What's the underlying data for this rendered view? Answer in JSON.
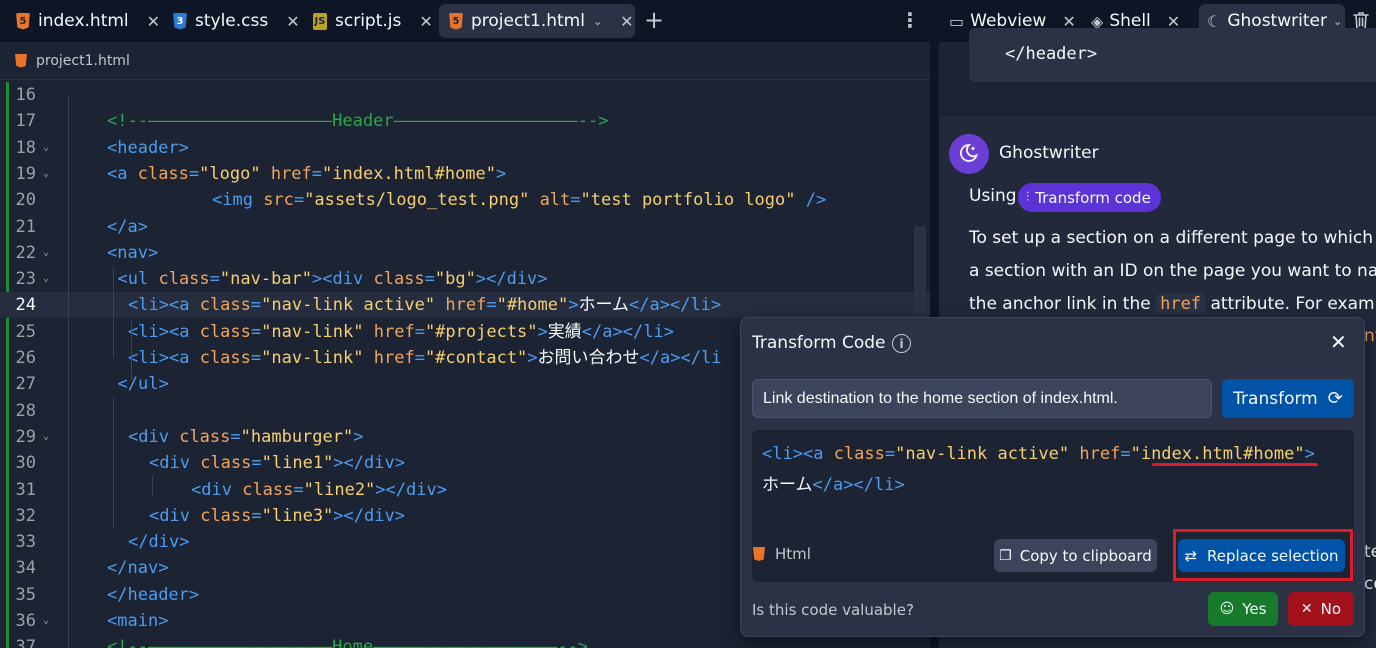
{
  "editor": {
    "tabs": [
      {
        "label": "index.html",
        "icon": "html-file-icon"
      },
      {
        "label": "style.css",
        "icon": "css-file-icon"
      },
      {
        "label": "script.js",
        "icon": "js-file-icon"
      },
      {
        "label": "project1.html",
        "icon": "html-file-icon",
        "active": true
      }
    ],
    "breadcrumb": "project1.html",
    "lines": [
      {
        "n": "16",
        "segs": []
      },
      {
        "n": "17",
        "segs": [
          [
            "com",
            "<!--――――――――――――――――――Header――――――――――――――――――-->"
          ]
        ]
      },
      {
        "n": "18",
        "fold": true,
        "segs": [
          [
            "tag",
            "<header"
          ],
          [
            "tag",
            ">"
          ]
        ]
      },
      {
        "n": "19",
        "fold": true,
        "segs": [
          [
            "tag",
            "<a "
          ],
          [
            "attr",
            "class"
          ],
          [
            "p",
            "="
          ],
          [
            "str",
            "\"logo\" "
          ],
          [
            "attr",
            "href"
          ],
          [
            "p",
            "="
          ],
          [
            "str",
            "\"index.html#home\""
          ],
          [
            "p",
            ">"
          ]
        ]
      },
      {
        "n": "20",
        "segs": [
          [
            "tag",
            "<img "
          ],
          [
            "attr",
            "src"
          ],
          [
            "p",
            "="
          ],
          [
            "str",
            "\"assets/logo_test.png\" "
          ],
          [
            "attr",
            "alt"
          ],
          [
            "p",
            "="
          ],
          [
            "str",
            "\"test portfolio logo\" "
          ],
          [
            "p",
            "/>"
          ]
        ]
      },
      {
        "n": "21",
        "segs": [
          [
            "p",
            "</"
          ],
          [
            "tag",
            "a"
          ],
          [
            "p",
            ">"
          ]
        ]
      },
      {
        "n": "22",
        "fold": true,
        "segs": [
          [
            "p",
            "<"
          ],
          [
            "tag",
            "nav"
          ],
          [
            "p",
            ">"
          ]
        ]
      },
      {
        "n": "23",
        "fold": true,
        "segs": [
          [
            "p",
            "<"
          ],
          [
            "tag",
            "ul "
          ],
          [
            "attr",
            "class"
          ],
          [
            "p",
            "="
          ],
          [
            "str",
            "\"nav-bar\""
          ],
          [
            "p",
            "><"
          ],
          [
            "tag",
            "div "
          ],
          [
            "attr",
            "class"
          ],
          [
            "p",
            "="
          ],
          [
            "str",
            "\"bg\""
          ],
          [
            "p",
            "></"
          ],
          [
            "tag",
            "div"
          ],
          [
            "p",
            ">"
          ]
        ]
      },
      {
        "n": "24",
        "segs": [
          [
            "p",
            "<"
          ],
          [
            "tag",
            "li"
          ],
          [
            "p",
            "><"
          ],
          [
            "tag",
            "a "
          ],
          [
            "attr",
            "class"
          ],
          [
            "p",
            "="
          ],
          [
            "str",
            "\"nav-link active\" "
          ],
          [
            "attr",
            "href"
          ],
          [
            "p",
            "="
          ],
          [
            "str",
            "\"#home\""
          ],
          [
            "p",
            ">"
          ],
          [
            "txt",
            "ホーム"
          ],
          [
            "p",
            "</"
          ],
          [
            "tag",
            "a"
          ],
          [
            "p",
            "></"
          ],
          [
            "tag",
            "li"
          ],
          [
            "p",
            ">"
          ]
        ]
      },
      {
        "n": "25",
        "segs": [
          [
            "p",
            "<"
          ],
          [
            "tag",
            "li"
          ],
          [
            "p",
            "><"
          ],
          [
            "tag",
            "a "
          ],
          [
            "attr",
            "class"
          ],
          [
            "p",
            "="
          ],
          [
            "str",
            "\"nav-link\" "
          ],
          [
            "attr",
            "href"
          ],
          [
            "p",
            "="
          ],
          [
            "str",
            "\"#projects\""
          ],
          [
            "p",
            ">"
          ],
          [
            "txt",
            "実績"
          ],
          [
            "p",
            "</"
          ],
          [
            "tag",
            "a"
          ],
          [
            "p",
            "></"
          ],
          [
            "tag",
            "li"
          ],
          [
            "p",
            ">"
          ]
        ]
      },
      {
        "n": "26",
        "segs": [
          [
            "p",
            "<"
          ],
          [
            "tag",
            "li"
          ],
          [
            "p",
            "><"
          ],
          [
            "tag",
            "a "
          ],
          [
            "attr",
            "class"
          ],
          [
            "p",
            "="
          ],
          [
            "str",
            "\"nav-link\" "
          ],
          [
            "attr",
            "href"
          ],
          [
            "p",
            "="
          ],
          [
            "str",
            "\"#contact\""
          ],
          [
            "p",
            ">"
          ],
          [
            "txt",
            "お問い合わせ"
          ],
          [
            "p",
            "</"
          ],
          [
            "tag",
            "a"
          ],
          [
            "p",
            "></"
          ],
          [
            "tag",
            "li"
          ]
        ]
      },
      {
        "n": "27",
        "segs": [
          [
            "p",
            "</"
          ],
          [
            "tag",
            "ul"
          ],
          [
            "p",
            ">"
          ]
        ]
      },
      {
        "n": "28",
        "segs": []
      },
      {
        "n": "29",
        "fold": true,
        "segs": [
          [
            "p",
            "<"
          ],
          [
            "tag",
            "div "
          ],
          [
            "attr",
            "class"
          ],
          [
            "p",
            "="
          ],
          [
            "str",
            "\"hamburger\""
          ],
          [
            "p",
            ">"
          ]
        ]
      },
      {
        "n": "30",
        "segs": [
          [
            "p",
            "<"
          ],
          [
            "tag",
            "div "
          ],
          [
            "attr",
            "class"
          ],
          [
            "p",
            "="
          ],
          [
            "str",
            "\"line1\""
          ],
          [
            "p",
            "></"
          ],
          [
            "tag",
            "div"
          ],
          [
            "p",
            ">"
          ]
        ]
      },
      {
        "n": "31",
        "segs": [
          [
            "p",
            "<"
          ],
          [
            "tag",
            "div "
          ],
          [
            "attr",
            "class"
          ],
          [
            "p",
            "="
          ],
          [
            "str",
            "\"line2\""
          ],
          [
            "p",
            "></"
          ],
          [
            "tag",
            "div"
          ],
          [
            "p",
            ">"
          ]
        ]
      },
      {
        "n": "32",
        "segs": [
          [
            "p",
            "<"
          ],
          [
            "tag",
            "div "
          ],
          [
            "attr",
            "class"
          ],
          [
            "p",
            "="
          ],
          [
            "str",
            "\"line3\""
          ],
          [
            "p",
            "></"
          ],
          [
            "tag",
            "div"
          ],
          [
            "p",
            ">"
          ]
        ]
      },
      {
        "n": "33",
        "segs": [
          [
            "p",
            "</"
          ],
          [
            "tag",
            "div"
          ],
          [
            "p",
            ">"
          ]
        ]
      },
      {
        "n": "34",
        "segs": [
          [
            "p",
            "</"
          ],
          [
            "tag",
            "nav"
          ],
          [
            "p",
            ">"
          ]
        ]
      },
      {
        "n": "35",
        "segs": [
          [
            "p",
            "</"
          ],
          [
            "tag",
            "header"
          ],
          [
            "p",
            ">"
          ]
        ]
      },
      {
        "n": "36",
        "fold": true,
        "segs": [
          [
            "p",
            "<"
          ],
          [
            "tag",
            "main"
          ],
          [
            "p",
            ">"
          ]
        ]
      },
      {
        "n": "37",
        "segs": [
          [
            "com",
            "<!--――――――――――――――――――Home――――――――――――――――――-->"
          ]
        ]
      }
    ]
  },
  "right": {
    "tabs": [
      {
        "label": "Webview",
        "icon": "monitor-icon"
      },
      {
        "label": "Shell",
        "icon": "shell-icon"
      },
      {
        "label": "Ghostwriter",
        "icon": "ghostwriter-icon",
        "active": true
      }
    ],
    "prev_code": "</header>",
    "assistant_name": "Ghostwriter",
    "using_label": "Using",
    "pill_label": "Transform code",
    "body_lines": [
      {
        "segs": [
          [
            "t",
            "To set up a section on a different page to which the l"
          ]
        ]
      },
      {
        "segs": [
          [
            "t",
            "a section with an ID on the page you want to navigat"
          ]
        ]
      },
      {
        "segs": [
          [
            "t",
            "the anchor link in the "
          ],
          [
            "c",
            "href"
          ],
          [
            "t",
            " attribute. For example,"
          ]
        ]
      }
    ],
    "orange_frag": "nt",
    "frag1": "te",
    "frag2": "co"
  },
  "popup": {
    "title": "Transform Code",
    "prompt_value": "Link destination to the home section of index.html.",
    "transform_label": "Transform",
    "code_lines": [
      {
        "segs": [
          [
            "p",
            "<"
          ],
          [
            "tag",
            "li"
          ],
          [
            "p",
            "><"
          ],
          [
            "tag",
            "a "
          ],
          [
            "attr",
            "class"
          ],
          [
            "p",
            "="
          ],
          [
            "str",
            "\"nav-link active\" "
          ],
          [
            "attr",
            "href"
          ],
          [
            "p",
            "="
          ],
          [
            "str",
            "\""
          ],
          [
            "str",
            "index.html#home"
          ],
          [
            "str",
            "\""
          ],
          [
            "p",
            ">"
          ]
        ]
      },
      {
        "segs": [
          [
            "txt",
            "ホーム"
          ],
          [
            "p",
            "</"
          ],
          [
            "tag",
            "a"
          ],
          [
            "p",
            "></"
          ],
          [
            "tag",
            "li"
          ],
          [
            "p",
            ">"
          ]
        ]
      }
    ],
    "language": "Html",
    "copy_label": "Copy to clipboard",
    "replace_label": "Replace selection",
    "feedback_question": "Is this code valuable?",
    "yes_label": "Yes",
    "no_label": "No"
  },
  "colors": {
    "tag": "#4c9cf0",
    "attr": "#f0a55c",
    "string": "#f7cf6f",
    "comment": "#2aa84a",
    "primary_button": "#0053a6",
    "highlight": "#e0192c"
  }
}
